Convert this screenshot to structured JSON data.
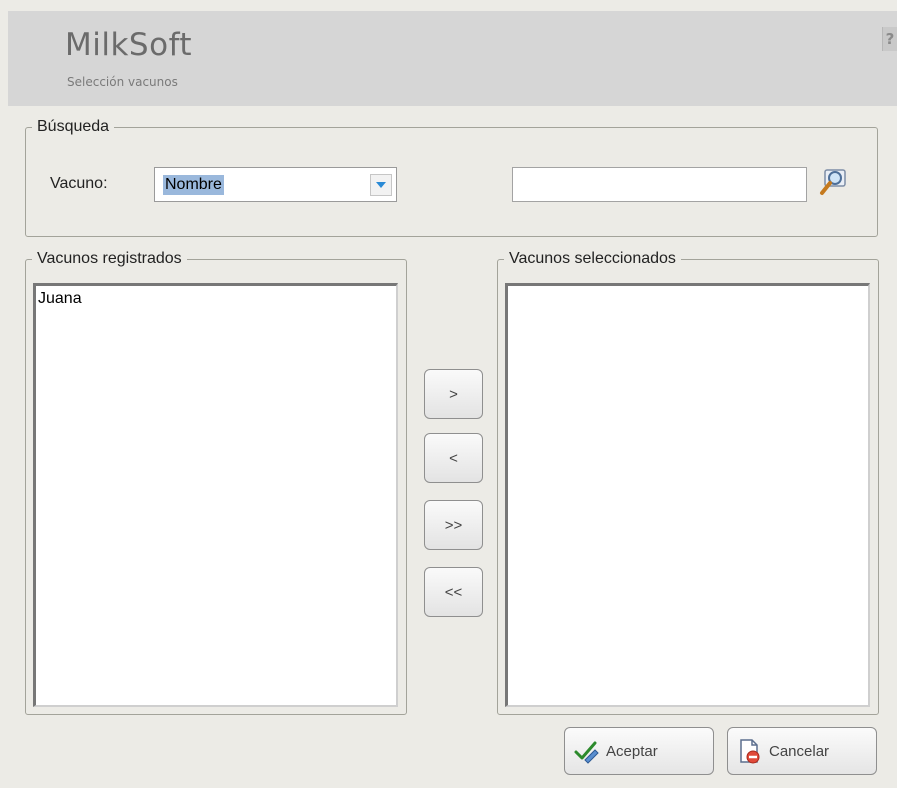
{
  "header": {
    "app_title": "MilkSoft",
    "subtitle": "Selección vacunos",
    "help_label": "?"
  },
  "search": {
    "group_label": "Búsqueda",
    "field_label": "Vacuno:",
    "combo_value": "Nombre",
    "text_value": ""
  },
  "registered": {
    "group_label": "Vacunos registrados",
    "items": [
      "Juana"
    ]
  },
  "selected": {
    "group_label": "Vacunos seleccionados",
    "items": []
  },
  "transfer": {
    "move_one": ">",
    "remove_one": "<",
    "move_all": ">>",
    "remove_all": "<<"
  },
  "actions": {
    "accept_label": "Aceptar",
    "cancel_label": "Cancelar"
  },
  "icons": {
    "search": "magnifier-icon",
    "accept": "checkmark-pencil-icon",
    "cancel": "document-cancel-icon",
    "dropdown": "chevron-down-icon"
  },
  "colors": {
    "accent": "#2a8ad6",
    "selection": "#9ab8dc"
  }
}
